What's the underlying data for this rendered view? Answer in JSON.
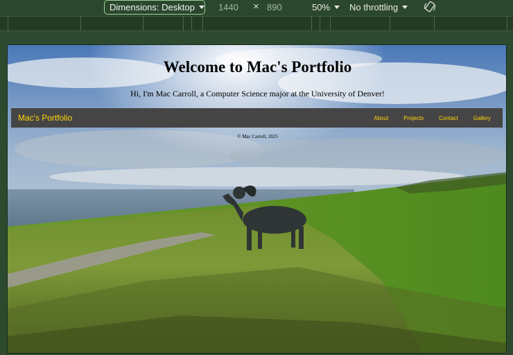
{
  "toolbar": {
    "dimensions_label": "Dimensions: Desktop",
    "width": "1440",
    "height": "890",
    "zoom": "50%",
    "throttling": "No throttling"
  },
  "site": {
    "title": "Welcome to Mac's Portfolio",
    "subtitle": "Hi, I'm Mac Carroll, a Computer Science major at the University of Denver!",
    "brand": "Mac's Portfolio",
    "nav": [
      "About",
      "Projects",
      "Contact",
      "Gallery"
    ],
    "footer": "© Mac Carroll, 2025",
    "background": "photo of a ram statue on a grassy coastal hillside under a cloudy sky",
    "accent_color": "#ffd60a",
    "navbar_color": "#454545"
  },
  "icons": {
    "rotate": "rotate-device-icon",
    "caret": "chevron-down-icon"
  }
}
